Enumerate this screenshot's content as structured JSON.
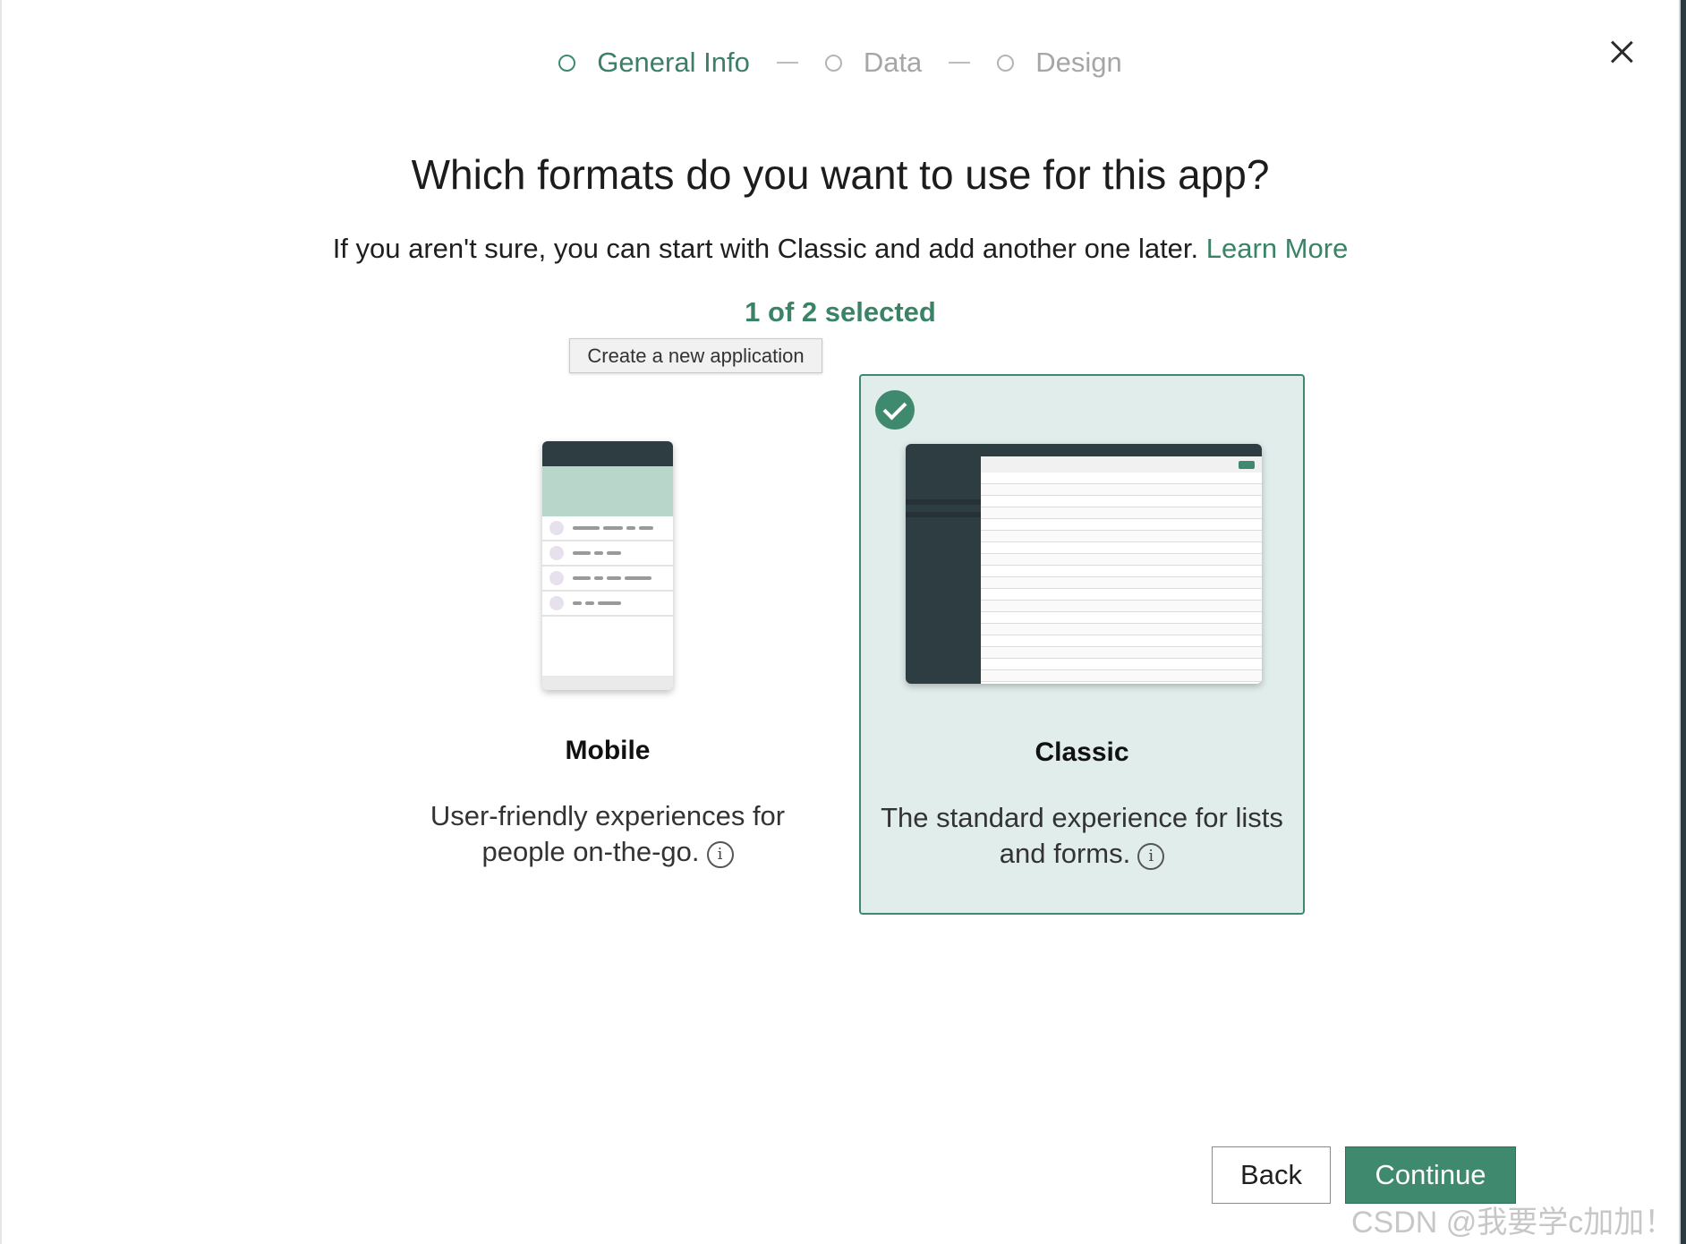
{
  "stepper": {
    "steps": [
      {
        "label": "General Info",
        "active": true
      },
      {
        "label": "Data",
        "active": false
      },
      {
        "label": "Design",
        "active": false
      }
    ]
  },
  "heading": "Which formats do you want to use for this app?",
  "subtitle": {
    "text": "If you aren't sure, you can start with Classic and add another one later.",
    "link": "Learn More"
  },
  "selection_count": "1 of 2 selected",
  "tooltip": "Create a new application",
  "cards": [
    {
      "name": "Mobile",
      "description": "User-friendly experiences for people on-the-go.",
      "selected": false
    },
    {
      "name": "Classic",
      "description": "The standard experience for lists and forms.",
      "selected": true
    }
  ],
  "footer": {
    "back_label": "Back",
    "continue_label": "Continue"
  },
  "watermark": "CSDN @我要学c加加！",
  "colors": {
    "accent": "#3f8a6f",
    "selected_card_bg": "#e1edeb",
    "dark_header": "#2e3d42"
  },
  "icons": {
    "close": "close-icon",
    "info": "info-icon",
    "check": "check-circle-icon"
  }
}
